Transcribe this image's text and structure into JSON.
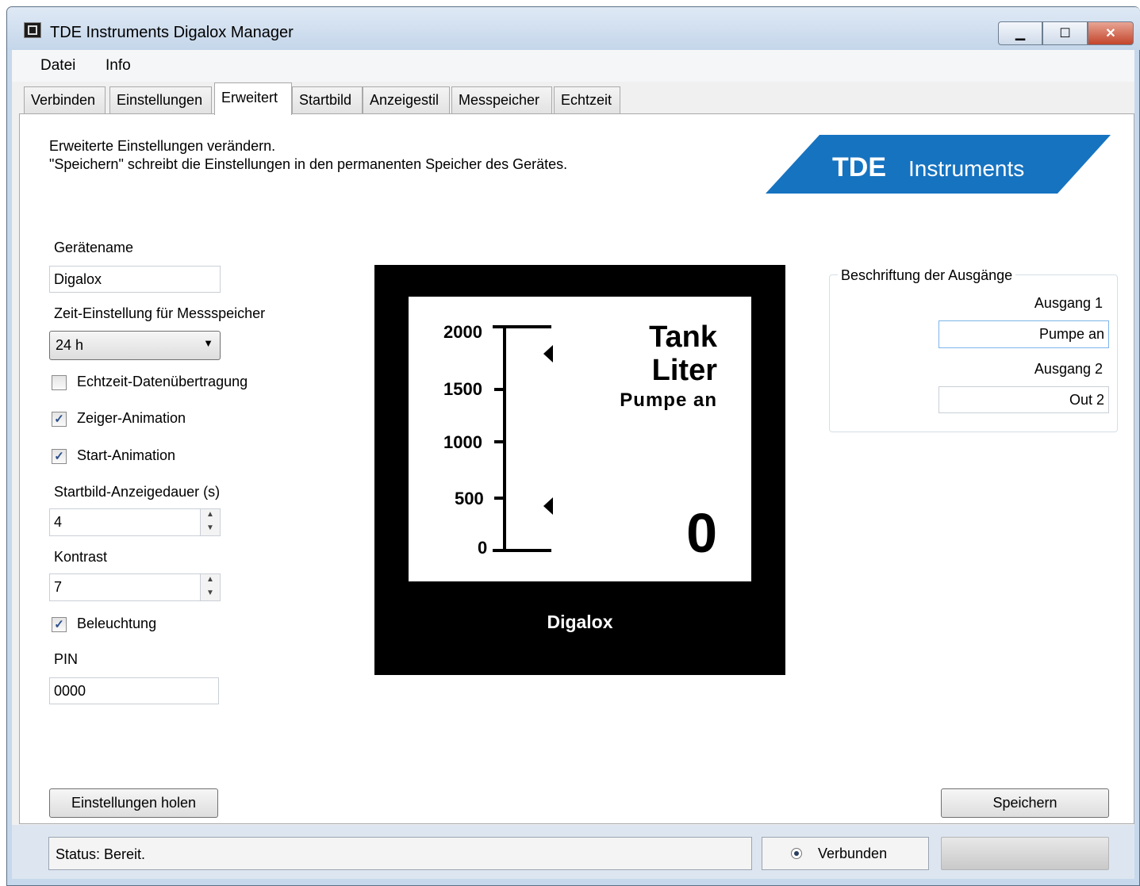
{
  "window": {
    "title": "TDE Instruments Digalox Manager",
    "controls": {
      "minimize": "▁",
      "maximize": "☐",
      "close": "✕"
    },
    "close_color": "#c3442b"
  },
  "menu": {
    "items": [
      "Datei",
      "Info"
    ]
  },
  "tabs": {
    "items": [
      "Verbinden",
      "Einstellungen",
      "Erweitert",
      "Startbild",
      "Anzeigestil",
      "Messpeicher",
      "Echtzeit"
    ],
    "active": "Erweitert"
  },
  "intro": {
    "line1": "Erweiterte Einstellungen verändern.",
    "line2": "\"Speichern\" schreibt die Einstellungen in den permanenten Speicher des Gerätes."
  },
  "logo": {
    "bold": "TDE",
    "rest": "Instruments",
    "color": "#1673c0"
  },
  "settings": {
    "device_name_label": "Gerätename",
    "device_name_value": "Digalox",
    "time_label": "Zeit-Einstellung für Messspeicher",
    "time_value": "24 h",
    "realtime_label": "Echtzeit-Datenübertragung",
    "realtime_checked": false,
    "pointer_anim_label": "Zeiger-Animation",
    "pointer_anim_checked": true,
    "start_anim_label": "Start-Animation",
    "start_anim_checked": true,
    "startscreen_label": "Startbild-Anzeigedauer (s)",
    "startscreen_value": "4",
    "contrast_label": "Kontrast",
    "contrast_value": "7",
    "backlight_label": "Beleuchtung",
    "backlight_checked": true,
    "pin_label": "PIN",
    "pin_value": "0000"
  },
  "device_preview": {
    "scale_ticks": [
      "2000",
      "1500",
      "1000",
      "500",
      "0"
    ],
    "title": "Tank",
    "unit": "Liter",
    "output_text": "Pumpe an",
    "value": "0",
    "brand": "Digalox"
  },
  "outputs": {
    "group_label": "Beschriftung der Ausgänge",
    "out1_label": "Ausgang 1",
    "out1_value": "Pumpe an",
    "out2_label": "Ausgang 2",
    "out2_value": "Out 2"
  },
  "buttons": {
    "fetch": "Einstellungen holen",
    "save": "Speichern"
  },
  "status": {
    "text": "Status: Bereit.",
    "connection": "Verbunden"
  }
}
